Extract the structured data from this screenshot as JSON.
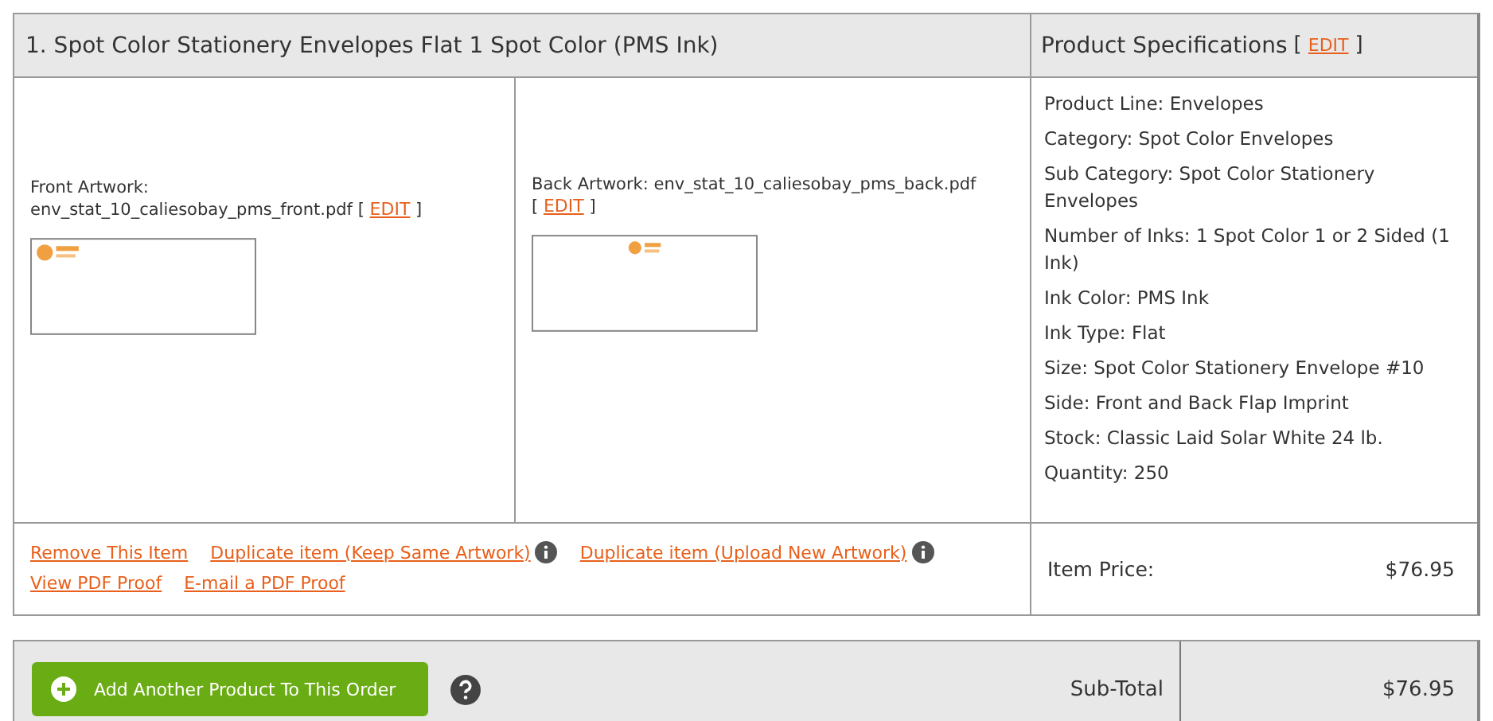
{
  "item": {
    "title": "1. Spot Color Stationery Envelopes Flat 1 Spot Color (PMS Ink)",
    "artwork": [
      {
        "kind": "front",
        "label": "Front Artwork:",
        "file": "env_stat_10_caliesobay_pms_front.pdf",
        "edit_open": "[",
        "edit": "EDIT",
        "edit_close": "]"
      },
      {
        "kind": "back",
        "label": "Back Artwork:",
        "file": "env_stat_10_caliesobay_pms_back.pdf",
        "edit_open": "[",
        "edit": "EDIT",
        "edit_close": "]"
      }
    ],
    "actions": [
      {
        "label": "Remove This Item",
        "info": false
      },
      {
        "label": "Duplicate item (Keep Same Artwork)",
        "info": true
      },
      {
        "label": "Duplicate item (Upload New Artwork)",
        "info": true
      },
      {
        "label": "View PDF Proof",
        "info": false
      },
      {
        "label": "E-mail a PDF Proof",
        "info": false
      }
    ]
  },
  "specs": {
    "title": "Product Specifications",
    "edit_open": "[",
    "edit": "EDIT",
    "edit_close": "]",
    "lines": [
      "Product Line: Envelopes",
      "Category: Spot Color Envelopes",
      "Sub Category: Spot Color Stationery Envelopes",
      "Number of Inks: 1 Spot Color 1 or 2 Sided (1 Ink)",
      "Ink Color: PMS Ink",
      "Ink Type: Flat",
      "Size: Spot Color Stationery Envelope #10",
      "Side: Front and Back Flap Imprint",
      "Stock: Classic Laid Solar White 24 lb.",
      "Quantity: 250"
    ],
    "price_label": "Item Price:",
    "price": "$76.95"
  },
  "footer": {
    "add_button": "Add Another Product To This Order",
    "help": true,
    "subtotal_label": "Sub-Total",
    "subtotal": "$76.95"
  }
}
